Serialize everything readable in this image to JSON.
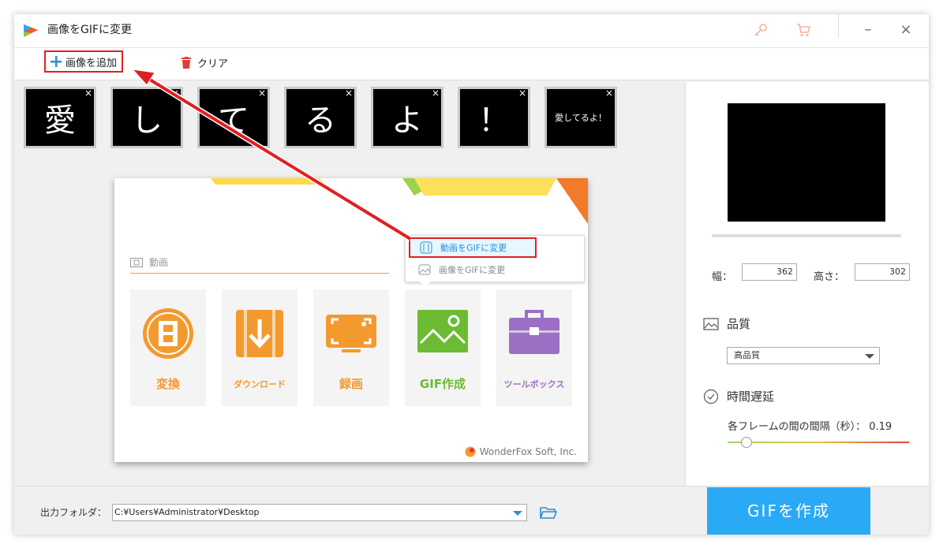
{
  "window": {
    "title": "画像をGIFに変更"
  },
  "toolbar": {
    "add_label": "画像を追加",
    "clear_label": "クリア"
  },
  "thumbnails": [
    "愛",
    "し",
    "て",
    "る",
    "よ",
    "！",
    "愛してるよ！"
  ],
  "thumb_close": "×",
  "screenshot": {
    "section_label": "動画",
    "popup": {
      "item1": "動画をGIFに変更",
      "item2": "画像をGIFに変更"
    },
    "tiles": [
      {
        "label": "変換",
        "color": "#f39a2f"
      },
      {
        "label": "ダウンロード",
        "color": "#f39a2f"
      },
      {
        "label": "録画",
        "color": "#f39a2f"
      },
      {
        "label": "GIF作成",
        "color": "#6cbb32"
      },
      {
        "label": "ツールボックス",
        "color": "#9b6fc4"
      }
    ],
    "brand": "WonderFox Soft, Inc."
  },
  "settings": {
    "width_label": "幅：",
    "width_value": "362",
    "height_label": "高さ：",
    "height_value": "302",
    "quality_heading": "品質",
    "quality_value": "高品質",
    "delay_heading": "時間遅延",
    "interval_label": "各フレームの間の間隔（秒）： 0.19"
  },
  "output": {
    "label": "出力フォルダ：",
    "path": "C:¥Users¥Administrator¥Desktop"
  },
  "create_button": "GIFを作成",
  "colors": {
    "accent_blue": "#2aa9f5",
    "highlight_red": "#e02020"
  }
}
